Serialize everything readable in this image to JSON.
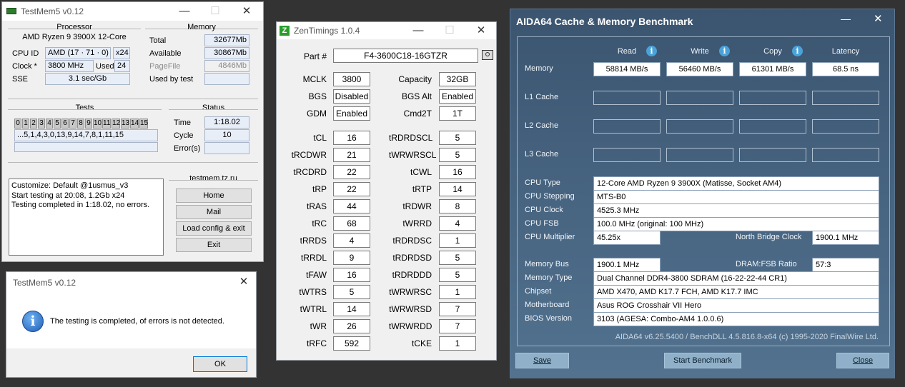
{
  "tm": {
    "title": "TestMem5 v0.12",
    "processor": {
      "title": "Processor",
      "name": "AMD Ryzen 9 3900X 12-Core",
      "cpuid_label": "CPU ID",
      "cpuid": "AMD  (17 · 71 · 0)",
      "threads": "x24",
      "clock_label": "Clock *",
      "clock": "3800 MHz",
      "used_label": "Used",
      "used": "24",
      "sse_label": "SSE",
      "sse": "3.1 sec/Gb"
    },
    "memory": {
      "title": "Memory",
      "total_label": "Total",
      "total": "32677Mb",
      "avail_label": "Available",
      "avail": "30867Mb",
      "pagefile_label": "PageFile",
      "pagefile": "4846Mb",
      "usedby_label": "Used by test",
      "usedby": ""
    },
    "tests": {
      "title": "Tests",
      "nums": [
        "0",
        "1",
        "2",
        "3",
        "4",
        "5",
        "6",
        "7",
        "8",
        "9",
        "10",
        "11",
        "12",
        "13",
        "14",
        "15"
      ],
      "sequence": "...5,1,4,3,0,13,9,14,7,8,1,11,15"
    },
    "status": {
      "title": "Status",
      "time_label": "Time",
      "time": "1:18.02",
      "cycle_label": "Cycle",
      "cycle": "10",
      "errors_label": "Error(s)",
      "errors": ""
    },
    "log": [
      "Customize: Default @1usmus_v3",
      "Start testing at 20:08, 1.2Gb x24",
      "Testing completed in 1:18.02, no errors."
    ],
    "links": {
      "title": "testmem.tz.ru",
      "home": "Home",
      "mail": "Mail",
      "load": "Load config & exit",
      "exit": "Exit"
    }
  },
  "dialog": {
    "title": "TestMem5 v0.12",
    "message": "The testing is completed, of errors is not detected.",
    "ok": "OK"
  },
  "zen": {
    "title": "ZenTimings 1.0.4",
    "logo": "Z",
    "part_label": "Part #",
    "part": "F4-3600C18-16GTZR",
    "top": [
      {
        "l1": "MCLK",
        "v1": "3800",
        "l2": "Capacity",
        "v2": "32GB"
      },
      {
        "l1": "BGS",
        "v1": "Disabled",
        "l2": "BGS Alt",
        "v2": "Enabled"
      },
      {
        "l1": "GDM",
        "v1": "Enabled",
        "l2": "Cmd2T",
        "v2": "1T"
      }
    ],
    "timings": [
      {
        "l1": "tCL",
        "v1": "16",
        "l2": "tRDRDSCL",
        "v2": "5"
      },
      {
        "l1": "tRCDWR",
        "v1": "21",
        "l2": "tWRWRSCL",
        "v2": "5"
      },
      {
        "l1": "tRCDRD",
        "v1": "22",
        "l2": "tCWL",
        "v2": "16"
      },
      {
        "l1": "tRP",
        "v1": "22",
        "l2": "tRTP",
        "v2": "14"
      },
      {
        "l1": "tRAS",
        "v1": "44",
        "l2": "tRDWR",
        "v2": "8"
      },
      {
        "l1": "tRC",
        "v1": "68",
        "l2": "tWRRD",
        "v2": "4"
      },
      {
        "l1": "tRRDS",
        "v1": "4",
        "l2": "tRDRDSC",
        "v2": "1"
      },
      {
        "l1": "tRRDL",
        "v1": "9",
        "l2": "tRDRDSD",
        "v2": "5"
      },
      {
        "l1": "tFAW",
        "v1": "16",
        "l2": "tRDRDDD",
        "v2": "5"
      },
      {
        "l1": "tWTRS",
        "v1": "5",
        "l2": "tWRWRSC",
        "v2": "1"
      },
      {
        "l1": "tWTRL",
        "v1": "14",
        "l2": "tWRWRSD",
        "v2": "7"
      },
      {
        "l1": "tWR",
        "v1": "26",
        "l2": "tWRWRDD",
        "v2": "7"
      },
      {
        "l1": "tRFC",
        "v1": "592",
        "l2": "tCKE",
        "v2": "1"
      }
    ]
  },
  "aida": {
    "title": "AIDA64 Cache & Memory Benchmark",
    "cols": [
      "Read",
      "Write",
      "Copy",
      "Latency"
    ],
    "rows": [
      {
        "label": "Memory",
        "vals": [
          "58814 MB/s",
          "56460 MB/s",
          "61301 MB/s",
          "68.5 ns"
        ]
      },
      {
        "label": "L1 Cache",
        "vals": [
          "",
          "",
          "",
          ""
        ]
      },
      {
        "label": "L2 Cache",
        "vals": [
          "",
          "",
          "",
          ""
        ]
      },
      {
        "label": "L3 Cache",
        "vals": [
          "",
          "",
          "",
          ""
        ]
      }
    ],
    "cpu_type_label": "CPU Type",
    "cpu_type": "12-Core AMD Ryzen 9 3900X  (Matisse, Socket AM4)",
    "cpu_step_label": "CPU Stepping",
    "cpu_step": "MTS-B0",
    "cpu_clock_label": "CPU Clock",
    "cpu_clock": "4525.3 MHz",
    "cpu_fsb_label": "CPU FSB",
    "cpu_fsb": "100.0 MHz  (original: 100 MHz)",
    "cpu_mult_label": "CPU Multiplier",
    "cpu_mult": "45.25x",
    "nb_label": "North Bridge Clock",
    "nb": "1900.1 MHz",
    "membus_label": "Memory Bus",
    "membus": "1900.1 MHz",
    "ratio_label": "DRAM:FSB Ratio",
    "ratio": "57:3",
    "memtype_label": "Memory Type",
    "memtype": "Dual Channel DDR4-3800 SDRAM  (16-22-22-44 CR1)",
    "chipset_label": "Chipset",
    "chipset": "AMD X470, AMD K17.7 FCH, AMD K17.7 IMC",
    "mobo_label": "Motherboard",
    "mobo": "Asus ROG Crosshair VII Hero",
    "bios_label": "BIOS Version",
    "bios": "3103  (AGESA: Combo-AM4 1.0.0.6)",
    "footer": "AIDA64 v6.25.5400 / BenchDLL 4.5.816.8-x64  (c) 1995-2020 FinalWire Ltd.",
    "save": "Save",
    "start": "Start Benchmark",
    "close": "Close"
  }
}
